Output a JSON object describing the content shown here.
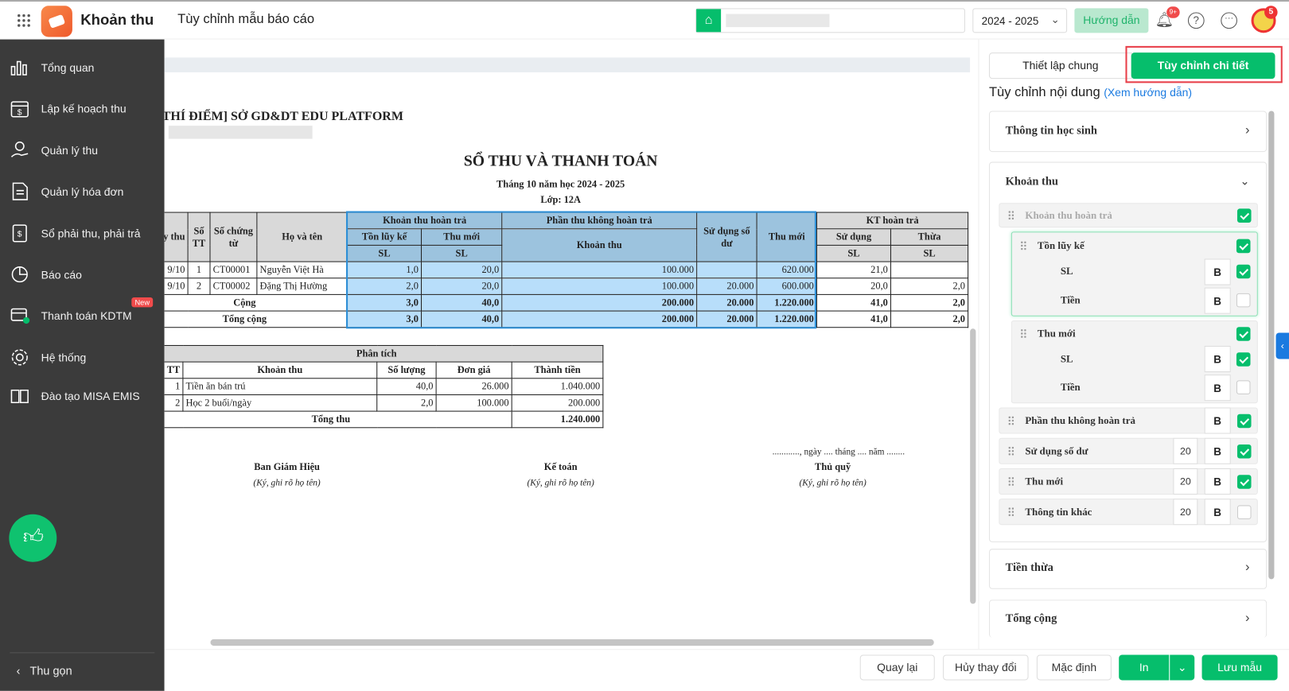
{
  "header": {
    "app_name": "Khoản thu",
    "page_title": "Tùy chỉnh mẫu báo cáo",
    "year": "2024 - 2025",
    "guide_button": "Hướng dẫn",
    "notif_badge": "9+",
    "avatar_badge": "5"
  },
  "sidebar": {
    "items": [
      {
        "label": "Tổng quan",
        "icon": "chart-icon"
      },
      {
        "label": "Lập kế hoạch thu",
        "icon": "calendar-money-icon"
      },
      {
        "label": "Quản lý thu",
        "icon": "hand-coin-icon"
      },
      {
        "label": "Quản lý hóa đơn",
        "icon": "invoice-icon"
      },
      {
        "label": "Sổ phải thu, phải trả",
        "icon": "ledger-icon"
      },
      {
        "label": "Báo cáo",
        "icon": "pie-chart-icon"
      },
      {
        "label": "Thanh toán KDTM",
        "icon": "payment-icon",
        "badge": "New"
      },
      {
        "label": "Hệ thống",
        "icon": "gear-icon"
      },
      {
        "label": "Đào tạo MISA EMIS",
        "icon": "book-icon"
      }
    ],
    "collapse": "Thu gọn"
  },
  "report": {
    "org": "[THÍ ĐIỂM] SỞ GD&DT EDU PLATFORM",
    "title": "SỔ THU VÀ THANH TOÁN",
    "subtitle": "Tháng 10 năm học 2024 - 2025",
    "class": "Lớp: 12A",
    "headers": {
      "ngay": "Ngày thu",
      "stt": "Số TT",
      "sct": "Số chứng từ",
      "name": "Họ và tên",
      "khtr": "Khoản thu hoàn trả",
      "tlk": "Tồn lũy kế",
      "thumoi": "Thu mới",
      "sl": "SL",
      "ptkht": "Phần thu không hoàn trả",
      "khoanthu": "Khoản thu",
      "sdsd": "Sử dụng số dư",
      "thumoi2": "Thu mới",
      "kthtr": "KT hoàn trả",
      "sudung": "Sử dụng",
      "thua": "Thừa"
    },
    "rows": [
      {
        "date": "9/10",
        "stt": "1",
        "voucher": "CT00001",
        "name": "Nguyễn Việt Hà",
        "tlk": "1,0",
        "tm": "20,0",
        "kt": "100.000",
        "sd": "",
        "thumoi": "620.000",
        "sudung": "21,0",
        "thua": ""
      },
      {
        "date": "9/10",
        "stt": "2",
        "voucher": "CT00002",
        "name": "Đặng Thị Hường",
        "tlk": "2,0",
        "tm": "20,0",
        "kt": "100.000",
        "sd": "20.000",
        "thumoi": "600.000",
        "sudung": "20,0",
        "thua": "2,0"
      }
    ],
    "cong": {
      "label": "Cộng",
      "tlk": "3,0",
      "tm": "40,0",
      "kt": "200.000",
      "sd": "20.000",
      "thumoi": "1.220.000",
      "sudung": "41,0",
      "thua": "2,0"
    },
    "tongcong": {
      "label": "Tổng cộng",
      "tlk": "3,0",
      "tm": "40,0",
      "kt": "200.000",
      "sd": "20.000",
      "thumoi": "1.220.000",
      "sudung": "41,0",
      "thua": "2,0"
    },
    "analysis": {
      "title": "Phân tích",
      "headers": [
        "TT",
        "Khoản thu",
        "Số lượng",
        "Đơn giá",
        "Thành tiền"
      ],
      "rows": [
        [
          "1",
          "Tiền ăn bán trú",
          "40,0",
          "26.000",
          "1.040.000"
        ],
        [
          "2",
          "Học 2 buổi/ngày",
          "2,0",
          "100.000",
          "200.000"
        ]
      ],
      "total_label": "Tổng thu",
      "total": "1.240.000"
    },
    "sign": {
      "date_line": "............, ngày .... tháng .... năm ........",
      "s1": "Ban Giám Hiệu",
      "s2": "Kế toán",
      "s3": "Thủ quỹ",
      "note": "(Ký, ghi rõ họ tên)"
    }
  },
  "panel": {
    "tab1": "Thiết lập chung",
    "tab2": "Tùy chỉnh chi tiết",
    "heading": "Tùy chỉnh nội dung",
    "guide_link": "(Xem hướng dẫn)",
    "sec_student": "Thông tin học sinh",
    "sec_khoanthu": "Khoản thu",
    "sec_tienthua": "Tiền thừa",
    "sec_tongcong": "Tổng cộng",
    "items": {
      "khtr": "Khoản thu hoàn trả",
      "tlk": "Tồn lũy kế",
      "sl": "SL",
      "tien": "Tiền",
      "thumoi": "Thu mới",
      "ptkht": "Phần thu không hoàn trả",
      "sdsd": "Sử dụng số dư",
      "thumoi2": "Thu mới",
      "ttk": "Thông tin khác",
      "bold": "B",
      "w_sdsd": "20",
      "w_thumoi": "20",
      "w_ttk": "20"
    }
  },
  "footer": {
    "back": "Quay lại",
    "cancel": "Hủy thay đổi",
    "default": "Mặc định",
    "print": "In",
    "save": "Lưu mẫu"
  },
  "colors": {
    "green": "#06be6c",
    "sidebar": "#3b3b3b",
    "blue": "#b8defa",
    "brand": "#f26b3a"
  }
}
